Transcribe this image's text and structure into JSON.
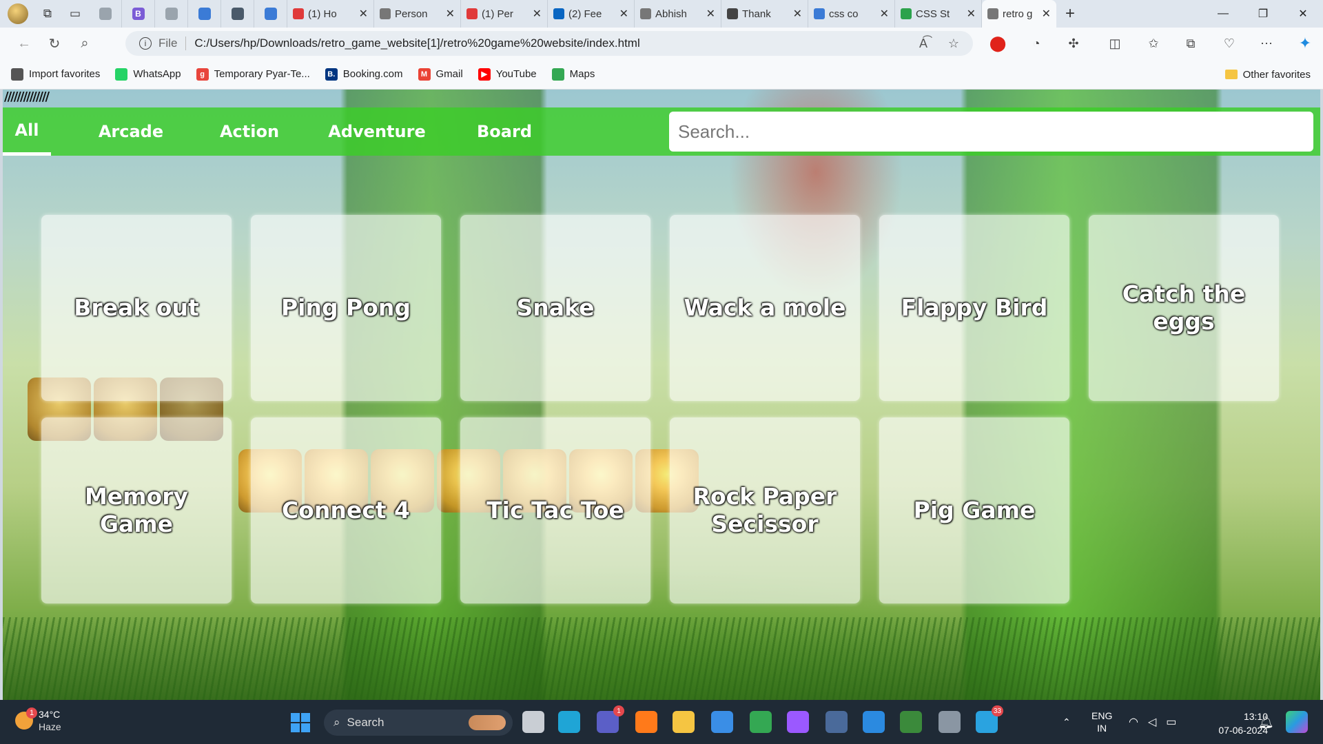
{
  "browser": {
    "tabs": [
      {
        "label": "",
        "color": "#9aa4ad"
      },
      {
        "label": "",
        "color": "#7b5cd6",
        "glyph": "B"
      },
      {
        "label": "",
        "color": "#9aa4ad"
      },
      {
        "label": "",
        "color": "#3b7bd6"
      },
      {
        "label": "",
        "color": "#4a5a6a"
      },
      {
        "label": "",
        "color": "#3b7bd6"
      }
    ],
    "open_tabs": [
      {
        "title": "(1) Ho",
        "color": "#e03a3a"
      },
      {
        "title": "Person",
        "color": "#777777"
      },
      {
        "title": "(1) Per",
        "color": "#e03a3a"
      },
      {
        "title": "(2) Fee",
        "color": "#0a66c2"
      },
      {
        "title": "Abhish",
        "color": "#777777"
      },
      {
        "title": "Thank",
        "color": "#444444"
      },
      {
        "title": "css co",
        "color": "#3b7bd6"
      },
      {
        "title": "CSS St",
        "color": "#2ca24c"
      },
      {
        "title": "retro g",
        "color": "#777777",
        "active": true
      }
    ],
    "address": {
      "scheme_label": "File",
      "url": "C:/Users/hp/Downloads/retro_game_website[1]/retro%20game%20website/index.html"
    },
    "favorites": [
      {
        "label": "Import favorites",
        "color": "#555555",
        "glyph": ""
      },
      {
        "label": "WhatsApp",
        "color": "#25d366",
        "glyph": ""
      },
      {
        "label": "Temporary Pyar-Te...",
        "color": "#e8453c",
        "glyph": "g"
      },
      {
        "label": "Booking.com",
        "color": "#003580",
        "glyph": "B."
      },
      {
        "label": "Gmail",
        "color": "#ea4335",
        "glyph": "M"
      },
      {
        "label": "YouTube",
        "color": "#ff0000",
        "glyph": "▶"
      },
      {
        "label": "Maps",
        "color": "#34a853",
        "glyph": ""
      }
    ],
    "other_favorites": "Other favorites"
  },
  "page": {
    "decoration": "//////////////",
    "categories": [
      "All",
      "Arcade",
      "Action",
      "Adventure",
      "Board"
    ],
    "active_category": "All",
    "search_placeholder": "Search...",
    "games": [
      "Break out",
      "Ping Pong",
      "Snake",
      "Wack a mole",
      "Flappy Bird",
      "Catch the eggs",
      "Memory Game",
      "Connect 4",
      "Tic Tac Toe",
      "Rock Paper Secissor",
      "Pig Game"
    ]
  },
  "taskbar": {
    "weather": {
      "temp": "34°C",
      "condition": "Haze",
      "badge": "1"
    },
    "search_label": "Search",
    "apps": [
      {
        "name": "task-view-icon",
        "color": "#c9ced4"
      },
      {
        "name": "edge-icon",
        "color": "#1fa5d6"
      },
      {
        "name": "teams-icon",
        "color": "#5b5fc7",
        "badge": "1"
      },
      {
        "name": "firefox-icon",
        "color": "#ff7a1a"
      },
      {
        "name": "file-explorer-icon",
        "color": "#f5c542"
      },
      {
        "name": "store-icon",
        "color": "#3a8ee6"
      },
      {
        "name": "chrome-icon",
        "color": "#34a853"
      },
      {
        "name": "affinity-icon",
        "color": "#9b59ff"
      },
      {
        "name": "app-icon",
        "color": "#4a6a9a"
      },
      {
        "name": "vscode-icon",
        "color": "#2b8ae0"
      },
      {
        "name": "sheet-icon",
        "color": "#3b8a3b"
      },
      {
        "name": "settings-icon",
        "color": "#8a96a3"
      },
      {
        "name": "telegram-icon",
        "color": "#2aa3e0",
        "badge": "33"
      }
    ],
    "language": {
      "line1": "ENG",
      "line2": "IN"
    },
    "time": "13:10",
    "date": "07-06-2024"
  }
}
